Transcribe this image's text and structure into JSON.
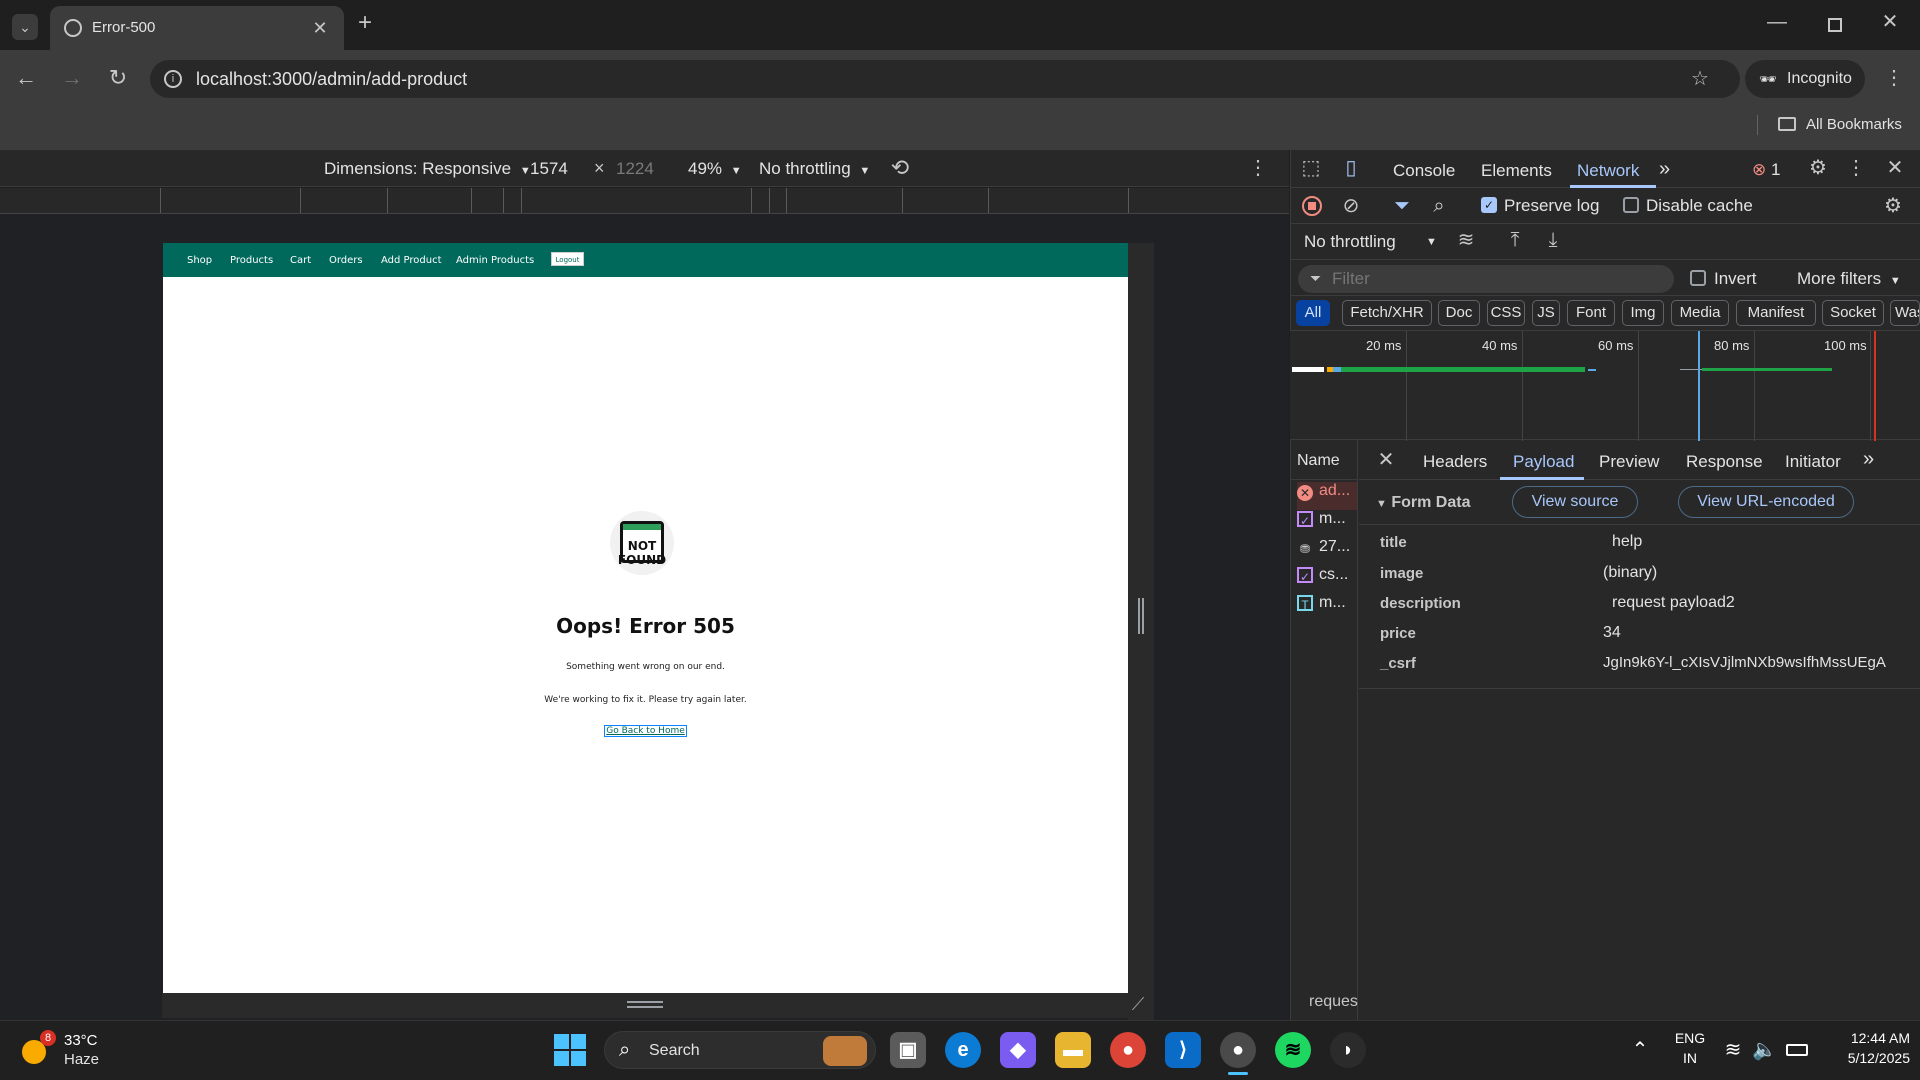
{
  "browser": {
    "tab_title": "Error-500",
    "url": "localhost:3000/admin/add-product",
    "incognito_label": "Incognito",
    "all_bookmarks_label": "All Bookmarks"
  },
  "device_toolbar": {
    "dimensions_label": "Dimensions: Responsive",
    "width_value": "1574",
    "times_symbol": "×",
    "height_value": "1224",
    "zoom": "49%",
    "throttling": "No throttling"
  },
  "site": {
    "nav": [
      "Shop",
      "Products",
      "Cart",
      "Orders",
      "Add Product",
      "Admin Products"
    ],
    "logout_label": "Logout",
    "logo_line1": "NOT",
    "logo_line2": "FOUND",
    "heading": "Oops! Error 505",
    "message1": "Something went wrong on our end.",
    "message2": "We're working to fix it. Please try again later.",
    "home_link": "Go Back to Home"
  },
  "devtools": {
    "tabs": [
      "Console",
      "Elements",
      "Network"
    ],
    "active_tab": "Network",
    "error_count": "1",
    "preserve_log_label": "Preserve log",
    "preserve_log_checked": true,
    "disable_cache_label": "Disable cache",
    "disable_cache_checked": false,
    "throttling": "No throttling",
    "filter_placeholder": "Filter",
    "invert_label": "Invert",
    "more_filters_label": "More filters",
    "type_filters": [
      "All",
      "Fetch/XHR",
      "Doc",
      "CSS",
      "JS",
      "Font",
      "Img",
      "Media",
      "Manifest",
      "Socket",
      "Was"
    ],
    "timeline_labels": [
      "20 ms",
      "40 ms",
      "60 ms",
      "80 ms",
      "100 ms"
    ],
    "name_header": "Name",
    "requests": [
      {
        "name": "ad...",
        "icon": "error-icon"
      },
      {
        "name": "m...",
        "icon": "stylesheet-icon"
      },
      {
        "name": "27...",
        "icon": "image-icon"
      },
      {
        "name": "cs...",
        "icon": "stylesheet-icon"
      },
      {
        "name": "m...",
        "icon": "text-file-icon"
      }
    ],
    "detail_tabs": [
      "Headers",
      "Payload",
      "Preview",
      "Response",
      "Initiator"
    ],
    "active_detail_tab": "Payload",
    "form_data_label": "Form Data",
    "view_source_label": "View source",
    "view_url_encoded_label": "View URL-encoded",
    "form_data": [
      {
        "key": "title",
        "value": "help"
      },
      {
        "key": "image",
        "value": "(binary)"
      },
      {
        "key": "description",
        "value": "request payload2"
      },
      {
        "key": "price",
        "value": "34"
      },
      {
        "key": "_csrf",
        "value": "JgIn9k6Y-l_cXIsVJjlmNXb9wsIfhMssUEgA"
      }
    ],
    "status_fragment": "reques"
  },
  "taskbar": {
    "weather_badge": "8",
    "temperature": "33°C",
    "condition": "Haze",
    "search_label": "Search",
    "language_line1": "ENG",
    "language_line2": "IN",
    "time": "12:44 AM",
    "date": "5/12/2025"
  },
  "colors": {
    "site_nav": "#00695c",
    "devtools_accent": "#a8c7fa",
    "error_red": "#f28b82",
    "timeline_green": "#1ea446"
  }
}
